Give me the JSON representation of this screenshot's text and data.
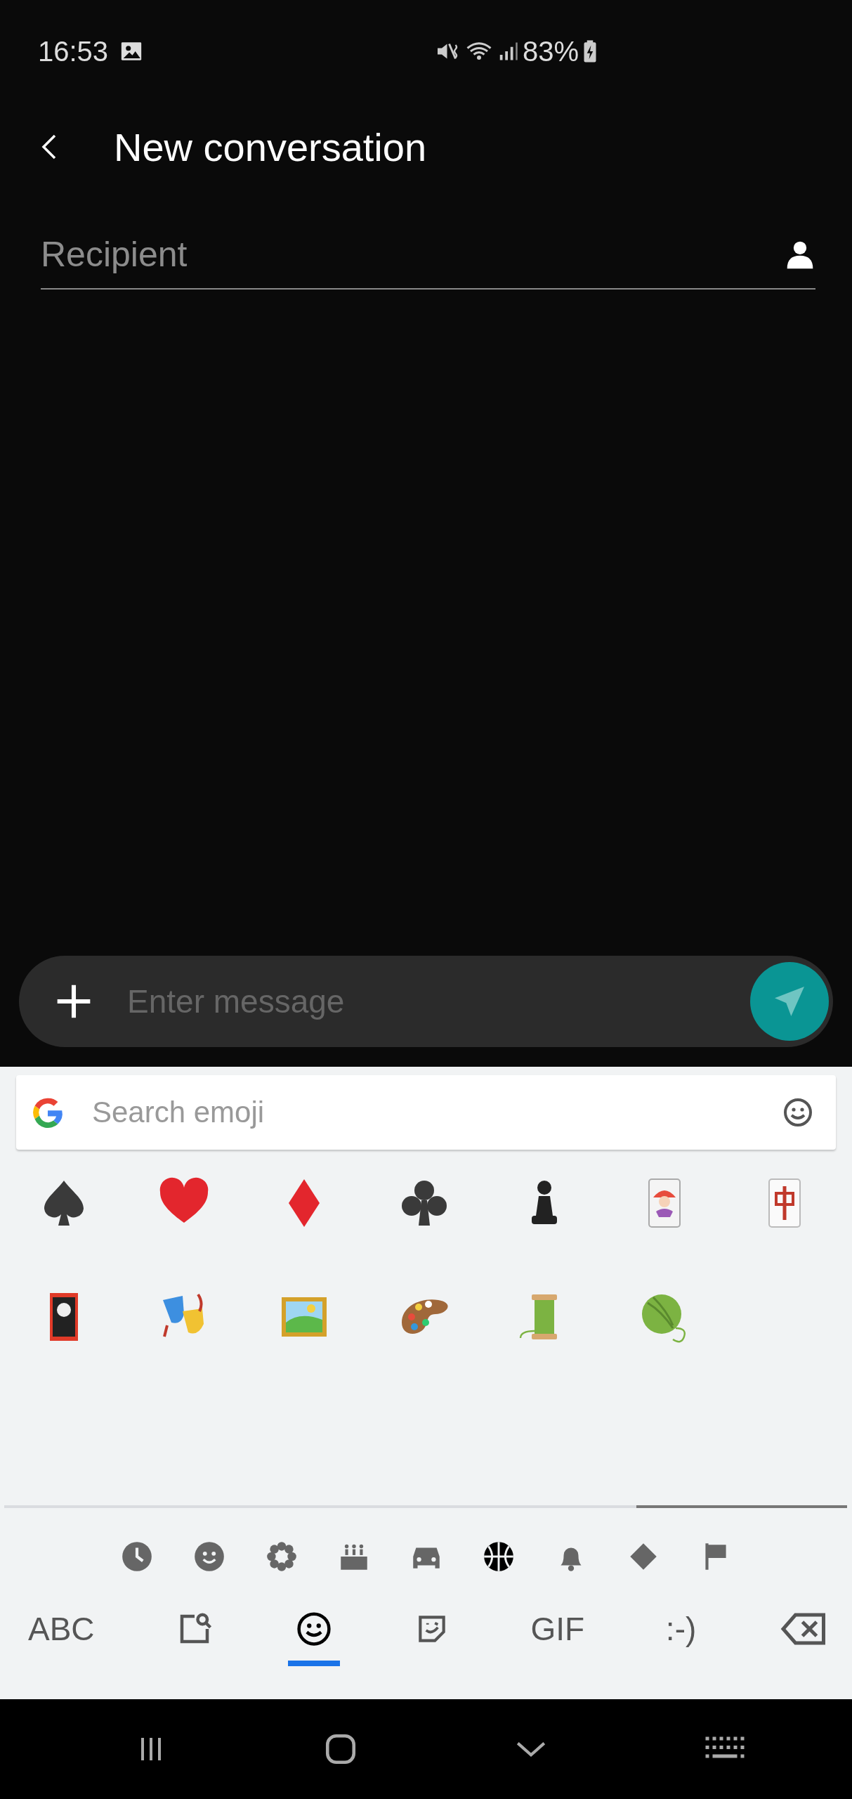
{
  "status_bar": {
    "time": "16:53",
    "battery": "83%"
  },
  "header": {
    "title": "New conversation"
  },
  "recipient": {
    "placeholder": "Recipient"
  },
  "composer": {
    "placeholder": "Enter message"
  },
  "keyboard": {
    "search": {
      "placeholder": "Search emoji"
    },
    "emoji": [
      {
        "kind": "spade"
      },
      {
        "kind": "heart"
      },
      {
        "kind": "diamond"
      },
      {
        "kind": "club"
      },
      {
        "kind": "pawn"
      },
      {
        "kind": "joker"
      },
      {
        "kind": "mahjong"
      },
      {
        "kind": "flower-card"
      },
      {
        "kind": "masks"
      },
      {
        "kind": "framed-picture"
      },
      {
        "kind": "palette"
      },
      {
        "kind": "thread"
      },
      {
        "kind": "yarn"
      }
    ],
    "categories": [
      {
        "kind": "recent",
        "selected": false
      },
      {
        "kind": "smileys",
        "selected": false
      },
      {
        "kind": "nature",
        "selected": false
      },
      {
        "kind": "food",
        "selected": false
      },
      {
        "kind": "travel",
        "selected": false
      },
      {
        "kind": "activities",
        "selected": true
      },
      {
        "kind": "objects",
        "selected": false
      },
      {
        "kind": "symbols",
        "selected": false
      },
      {
        "kind": "flags",
        "selected": false
      }
    ],
    "modes": [
      {
        "kind": "text",
        "label": "ABC",
        "selected": false
      },
      {
        "kind": "search",
        "selected": false
      },
      {
        "kind": "emoji",
        "selected": true
      },
      {
        "kind": "sticker",
        "selected": false
      },
      {
        "kind": "text",
        "label": "GIF",
        "selected": false
      },
      {
        "kind": "text",
        "label": ":-)",
        "selected": false
      },
      {
        "kind": "delete",
        "selected": false
      }
    ]
  }
}
